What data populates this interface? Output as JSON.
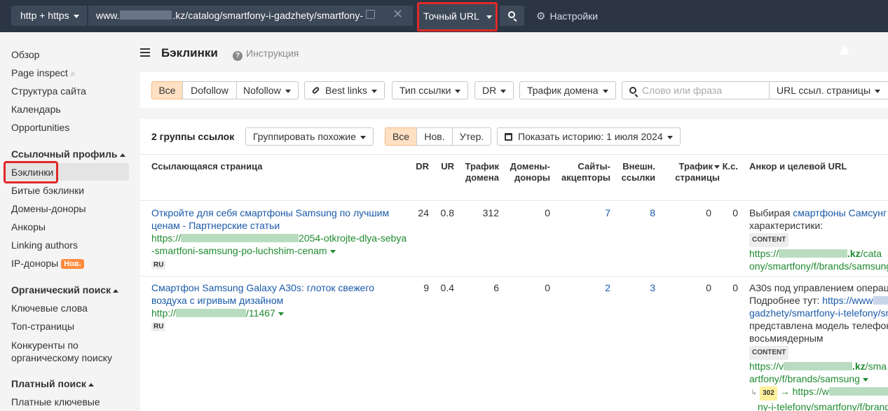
{
  "topbar": {
    "protocol": "http + https",
    "url_prefix": "www.",
    "url_suffix": ".kz/catalog/smartfony-i-gadzhety/smartfony-",
    "mode": "Точный URL",
    "settings": "Настройки"
  },
  "sidebar": {
    "items_top": [
      "Обзор",
      "Page inspect",
      "Структура сайта",
      "Календарь",
      "Opportunities"
    ],
    "section_links": "Ссылочный профиль",
    "links_items": [
      "Бэклинки",
      "Битые бэклинки",
      "Домены-доноры",
      "Анкоры",
      "Linking authors",
      "IP-доноры"
    ],
    "new_badge": "Нов.",
    "section_organic": "Органический поиск",
    "organic_items": [
      "Ключевые слова",
      "Топ-страницы",
      "Конкуренты по",
      "органическому поиску"
    ],
    "section_paid": "Платный поиск",
    "paid_items": [
      "Платные ключевые"
    ]
  },
  "header": {
    "title": "Бэклинки",
    "help": "Инструкция"
  },
  "filters": {
    "all": "Все",
    "dofollow": "Dofollow",
    "nofollow": "Nofollow",
    "best_links": "Best links",
    "link_type": "Тип ссылки",
    "dr": "DR",
    "domain_traffic": "Трафик домена",
    "search_placeholder": "Слово или фраза",
    "url_scope": "URL ссыл. страницы"
  },
  "groups_bar": {
    "groups_count": "2 группы ссылок",
    "group_similar": "Группировать похожие",
    "all": "Все",
    "new": "Нов.",
    "lost": "Утер.",
    "history": "Показать историю: 1 июля 2024"
  },
  "table": {
    "columns": {
      "page": "Ссылающаяся страница",
      "dr": "DR",
      "ur": "UR",
      "domain_traffic_1": "Трафик",
      "domain_traffic_2": "домена",
      "donors_1": "Домены-",
      "donors_2": "доноры",
      "acceptors_1": "Сайты-",
      "acceptors_2": "акцепторы",
      "ext_1": "Внешн.",
      "ext_2": "ссылки",
      "page_traffic_1": "Трафик",
      "page_traffic_2": "страницы",
      "kw": "К.с.",
      "anchor": "Анкор и целевой URL"
    },
    "rows": [
      {
        "title_1": "Откройте для себя смартфоны Samsung по лучшим",
        "title_2": "ценам - Партнерские статьи",
        "url_1a": "https://",
        "url_1b": "2054-otkrojte-dlya-sebya",
        "url_2": "-smartfoni-samsung-po-luchshim-cenam",
        "lang": "RU",
        "dr": "24",
        "ur": "0.8",
        "domain_traffic": "312",
        "donors": "0",
        "acceptors": "7",
        "ext_links": "8",
        "page_traffic": "0",
        "kw": "0",
        "anchor_1a": "Выбирая ",
        "anchor_1b": "смартфоны Самсунг",
        "anchor_2": "характеристики:",
        "tag": "CONTENT",
        "target_1a": "https://",
        "target_1b": ".kz",
        "target_1c": "/cata",
        "target_2": "ony/smartfony/f/brands/samsung"
      },
      {
        "title_1": "Смартфон Samsung Galaxy A30s: глоток свежего",
        "title_2": "воздуха с игривым дизайном",
        "url_1a": "http://",
        "url_1b": "/11467",
        "lang": "RU",
        "dr": "9",
        "ur": "0.4",
        "domain_traffic": "6",
        "donors": "0",
        "acceptors": "2",
        "ext_links": "3",
        "page_traffic": "0",
        "kw": "0",
        "anchor_1": "A30s под управлением операц",
        "anchor_2a": "Подробнее тут: ",
        "anchor_2b": "https://www",
        "anchor_3": "gadzhety/smartfony-i-telefony/sm",
        "anchor_4": "представлена модель телефон",
        "anchor_5": "восьмиядерным",
        "tag": "CONTENT",
        "target_1a": "https://v",
        "target_1b": ".kz",
        "target_1c": "/sma",
        "target_2": "artfony/f/brands/samsung",
        "redirect": "302",
        "redirect_url": "https://w",
        "redirect_2": "ny-i-telefony/smartfony/f/brands"
      }
    ]
  }
}
